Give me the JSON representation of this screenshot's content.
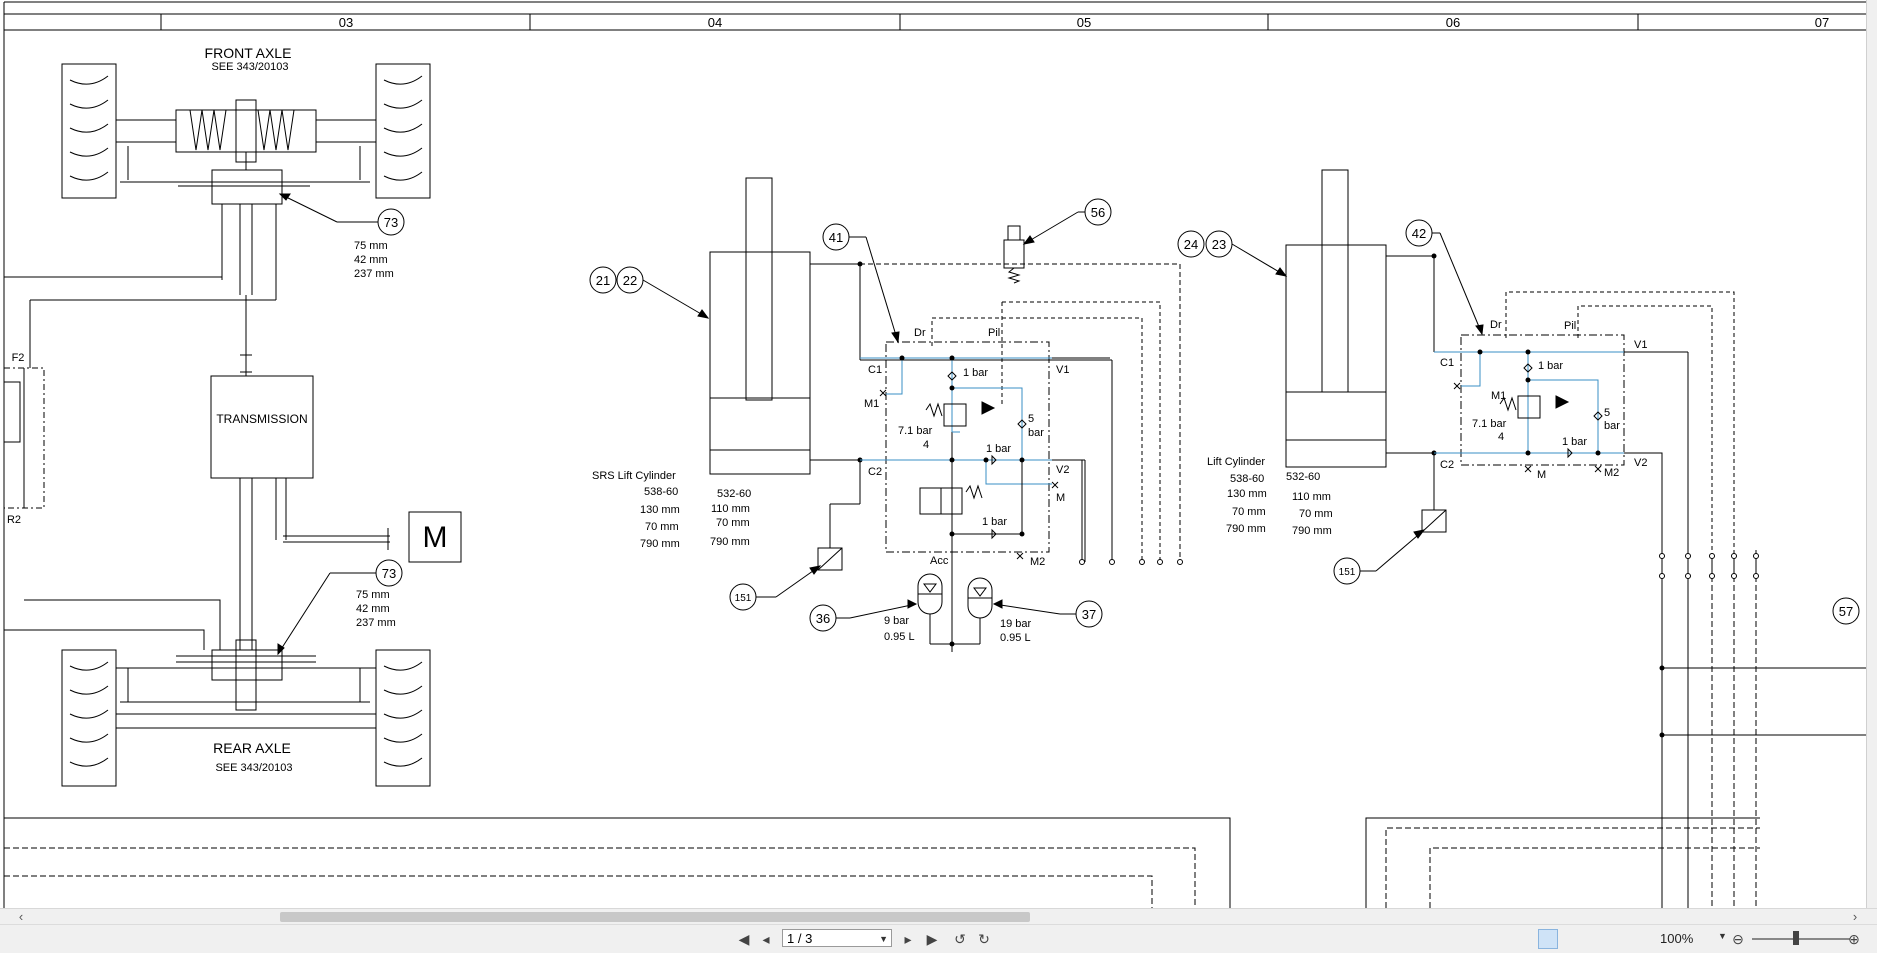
{
  "columns": [
    "03",
    "04",
    "05",
    "06",
    "07"
  ],
  "front_axle": {
    "title": "FRONT AXLE",
    "ref": "SEE 343/20103"
  },
  "rear_axle": {
    "title": "REAR AXLE",
    "ref": "SEE 343/20103"
  },
  "transmission": {
    "label": "TRANSMISSION"
  },
  "motor": {
    "label": "M"
  },
  "fuse_labels": {
    "f2": "F2",
    "r2": "R2"
  },
  "callouts": {
    "c73a": "73",
    "c73b": "73",
    "c21": "21",
    "c22": "22",
    "c41": "41",
    "c56": "56",
    "c24": "24",
    "c23": "23",
    "c42": "42",
    "c151a": "151",
    "c151b": "151",
    "c36": "36",
    "c37": "37",
    "c57": "57"
  },
  "dims_73a": [
    "75 mm",
    "42 mm",
    "237 mm"
  ],
  "dims_73b": [
    "75 mm",
    "42 mm",
    "237 mm"
  ],
  "srs_cylinder": {
    "title": "SRS Lift Cylinder",
    "left": [
      "538-60",
      "130 mm",
      "70 mm",
      "790 mm"
    ],
    "right": [
      "532-60",
      "110 mm",
      "70 mm",
      "790 mm"
    ]
  },
  "lift_cylinder": {
    "title": "Lift Cylinder",
    "left": [
      "538-60",
      "130 mm",
      "70 mm",
      "790 mm"
    ],
    "right": [
      "532-60",
      "110 mm",
      "70 mm",
      "790 mm"
    ]
  },
  "valve1": {
    "dr": "Dr",
    "pil": "Pil",
    "c1": "C1",
    "c2": "C2",
    "m1": "M1",
    "v1": "V1",
    "v2": "V2",
    "m": "M",
    "m2": "M2",
    "acc": "Acc",
    "bar1a": "1 bar",
    "bar1b": "1 bar",
    "bar1c": "1 bar",
    "bar71": "7.1 bar",
    "four": "4",
    "five": "5",
    "bar": "bar"
  },
  "valve2": {
    "dr": "Dr",
    "pil": "Pil",
    "c1": "C1",
    "c2": "C2",
    "m1": "M1",
    "v1": "V1",
    "v2": "V2",
    "m": "M",
    "m2": "M2",
    "bar1a": "1 bar",
    "bar1b": "1 bar",
    "bar71": "7.1 bar",
    "four": "4",
    "five": "5",
    "bar": "bar"
  },
  "accumulators": {
    "a36": [
      "9 bar",
      "0.95 L"
    ],
    "a37": [
      "19 bar",
      "0.95 L"
    ]
  },
  "toolbar": {
    "page_value": "1 / 3",
    "zoom": "100%"
  },
  "icons": {
    "first": "first-page-icon",
    "prev": "prev-page-icon",
    "next": "next-page-icon",
    "last": "last-page-icon",
    "zoom_out": "zoom-out-icon",
    "zoom_in": "zoom-in-icon"
  },
  "colors": {
    "hydraulic_blue": "#3a8fc4",
    "line": "#000000",
    "toolbar_bg": "#f0f0f0"
  }
}
